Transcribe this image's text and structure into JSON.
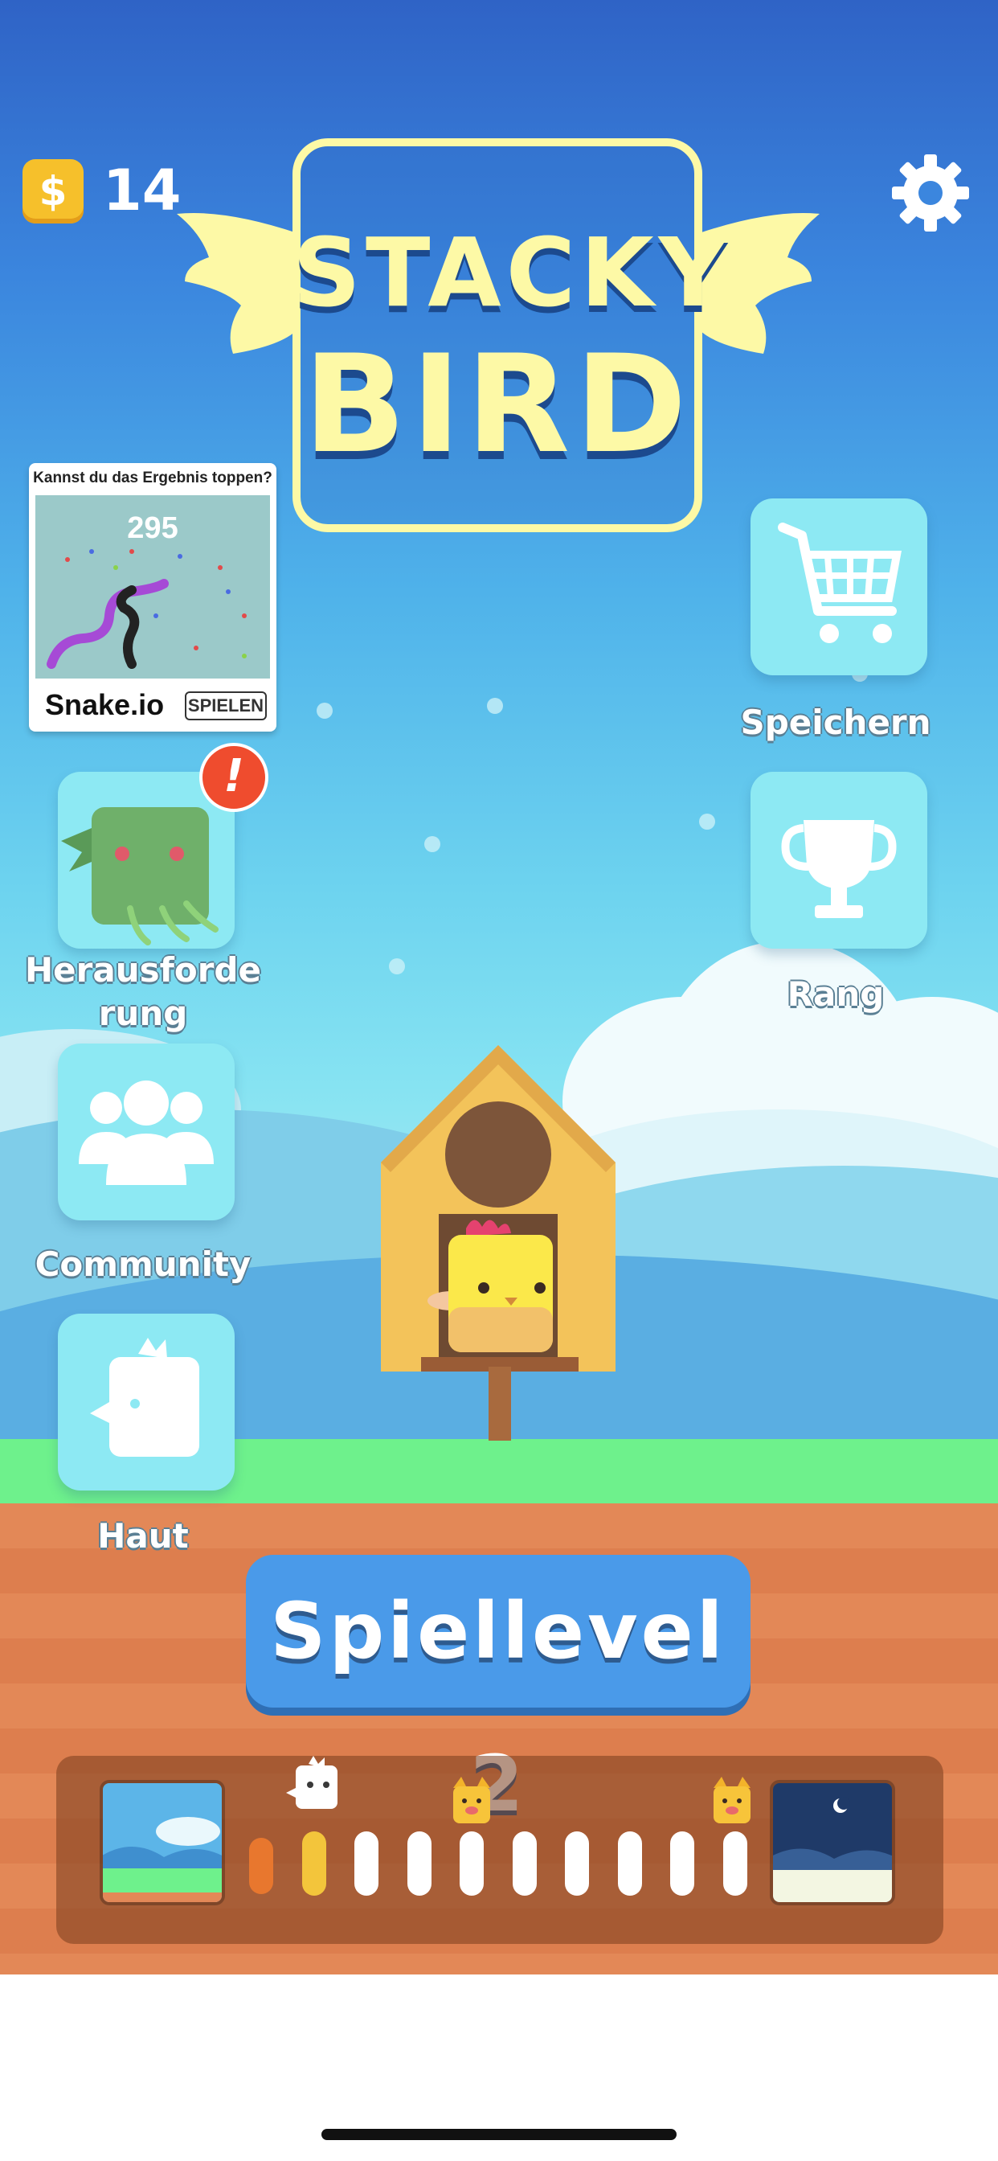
{
  "hud": {
    "coin_symbol": "$",
    "coin_count": "14",
    "settings_icon": "gear-icon"
  },
  "logo": {
    "line1": "STACKY",
    "line2": "BIRD"
  },
  "ad": {
    "headline": "Kannst du das Ergebnis toppen?",
    "score": "295",
    "game_name": "Snake.io",
    "cta": "SPIELEN"
  },
  "menu": {
    "challenge": {
      "label_line1": "Herausforde",
      "label_line2": "rung",
      "badge": "!",
      "icon": "monster-icon"
    },
    "community": {
      "label": "Community",
      "icon": "people-icon"
    },
    "skin": {
      "label": "Haut",
      "icon": "bird-icon"
    },
    "shop": {
      "label": "Speichern",
      "icon": "cart-icon"
    },
    "rank": {
      "label": "Rang",
      "icon": "trophy-icon"
    }
  },
  "play": {
    "label": "Spiellevel 2"
  },
  "progress": {
    "current_step": 2,
    "total_steps": 10,
    "start_world": "day-landscape",
    "end_world": "night-landscape",
    "colors": {
      "done": "#e8772e",
      "current": "#f3c53b",
      "todo": "#ffffff"
    }
  }
}
